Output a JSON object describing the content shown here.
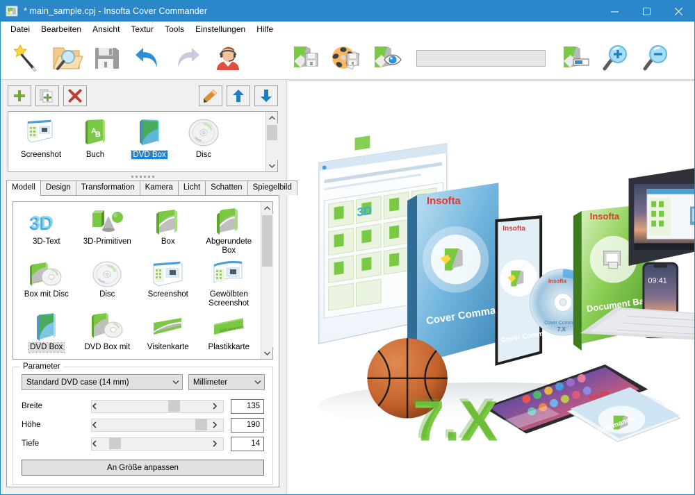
{
  "window": {
    "title": "* main_sample.cpj - Insofta Cover Commander",
    "app_icon": "cover-commander-icon",
    "controls": {
      "minimize": "—",
      "maximize": "☐",
      "close": "✕"
    },
    "accent_color": "#2b87c9"
  },
  "menu": {
    "items": [
      {
        "label": "Datei",
        "name": "menu-datei"
      },
      {
        "label": "Bearbeiten",
        "name": "menu-bearbeiten"
      },
      {
        "label": "Ansicht",
        "name": "menu-ansicht"
      },
      {
        "label": "Textur",
        "name": "menu-textur"
      },
      {
        "label": "Tools",
        "name": "menu-tools"
      },
      {
        "label": "Einstellungen",
        "name": "menu-einstellungen"
      },
      {
        "label": "Hilfe",
        "name": "menu-hilfe"
      }
    ]
  },
  "toolbar": {
    "left_buttons": [
      {
        "icon": "magic-wand-icon",
        "name": "new-wizard-button"
      },
      {
        "icon": "open-folder-search-icon",
        "name": "open-project-button"
      },
      {
        "icon": "floppy-save-icon",
        "name": "save-project-button"
      },
      {
        "icon": "undo-arrow-icon",
        "name": "undo-button"
      },
      {
        "icon": "redo-arrow-icon",
        "name": "redo-button"
      },
      {
        "icon": "support-headset-icon",
        "name": "support-button"
      }
    ],
    "mid_buttons": [
      {
        "icon": "save-image-icon",
        "name": "save-image-button"
      },
      {
        "icon": "render-film-icon",
        "name": "render-animation-button"
      },
      {
        "icon": "preview-eye-icon",
        "name": "preview-button"
      }
    ],
    "progress_field": {
      "value": "",
      "name": "render-progress-bar"
    },
    "right_buttons": [
      {
        "icon": "batch-render-icon",
        "name": "batch-render-button"
      },
      {
        "icon": "zoom-in-icon",
        "name": "zoom-in-button"
      },
      {
        "icon": "zoom-out-icon",
        "name": "zoom-out-button"
      }
    ]
  },
  "object_panel": {
    "buttons": [
      {
        "icon": "plus-icon",
        "name": "add-object-button"
      },
      {
        "icon": "duplicate-page-plus-icon",
        "name": "duplicate-object-button"
      },
      {
        "icon": "red-x-icon",
        "name": "delete-object-button"
      },
      {
        "icon": "pencil-icon",
        "name": "rename-object-button"
      },
      {
        "icon": "arrow-up-icon",
        "name": "move-up-button"
      },
      {
        "icon": "arrow-down-icon",
        "name": "move-down-button"
      }
    ],
    "items": [
      {
        "label": "Screenshot",
        "icon": "screenshot-thumb-icon",
        "selected": false
      },
      {
        "label": "Buch",
        "icon": "book-thumb-icon",
        "selected": false
      },
      {
        "label": "DVD Box",
        "icon": "dvdbox-thumb-icon",
        "selected": true
      },
      {
        "label": "Disc",
        "icon": "disc-thumb-icon",
        "selected": false
      }
    ],
    "scrollbar": {
      "up": "⌃",
      "down": "⌄",
      "thumb_top_pct": 5,
      "thumb_height_pct": 38
    }
  },
  "tabs": {
    "items": [
      {
        "label": "Modell",
        "active": true
      },
      {
        "label": "Design",
        "active": false
      },
      {
        "label": "Transformation",
        "active": false
      },
      {
        "label": "Kamera",
        "active": false
      },
      {
        "label": "Licht",
        "active": false
      },
      {
        "label": "Schatten",
        "active": false
      },
      {
        "label": "Spiegelbild",
        "active": false
      }
    ]
  },
  "model_gallery": {
    "items": [
      {
        "label": "3D-Text",
        "icon": "3d-text-icon",
        "selected": false
      },
      {
        "label": "3D-Primitiven",
        "icon": "3d-primitives-icon",
        "selected": false
      },
      {
        "label": "Box",
        "icon": "box-icon",
        "selected": false
      },
      {
        "label": "Abgerundete Box",
        "icon": "rounded-box-icon",
        "selected": false
      },
      {
        "label": "Box mit Disc",
        "icon": "box-with-disc-icon",
        "selected": false
      },
      {
        "label": "Disc",
        "icon": "disc-icon",
        "selected": false
      },
      {
        "label": "Screenshot",
        "icon": "screenshot-icon",
        "selected": false
      },
      {
        "label": "Gewölbten Screenshot",
        "icon": "curved-screenshot-icon",
        "selected": false
      },
      {
        "label": "DVD Box",
        "icon": "dvd-box-icon",
        "selected": true
      },
      {
        "label": "DVD Box mit",
        "icon": "dvd-box-with-disc-icon",
        "selected": false
      },
      {
        "label": "Visitenkarte",
        "icon": "business-card-icon",
        "selected": false
      },
      {
        "label": "Plastikkarte",
        "icon": "plastic-card-icon",
        "selected": false
      }
    ],
    "scrollbar": {
      "up": "⌃",
      "down": "⌄",
      "thumb_top_pct": 2,
      "thumb_height_pct": 40
    }
  },
  "parameters": {
    "legend": "Parameter",
    "preset": {
      "value": "Standard DVD case (14 mm)",
      "chevron": "⌄"
    },
    "unit": {
      "value": "Millimeter",
      "chevron": "⌄"
    },
    "sliders": [
      {
        "label": "Breite",
        "value": "135",
        "pct": 62,
        "left_arrow": "‹",
        "right_arrow": "›"
      },
      {
        "label": "Höhe",
        "value": "190",
        "pct": 86,
        "left_arrow": "‹",
        "right_arrow": "›"
      },
      {
        "label": "Tiefe",
        "value": "14",
        "pct": 9,
        "left_arrow": "‹",
        "right_arrow": "›"
      }
    ],
    "fit_button": "An Größe anpassen"
  },
  "preview": {
    "name": "render-preview-canvas",
    "scene": "3d-product-montage",
    "brand": "Insofta",
    "version_text": "7.X",
    "product_text": "Cover Commander",
    "backup_text": "Document Backup",
    "phone_time": "09:41"
  }
}
